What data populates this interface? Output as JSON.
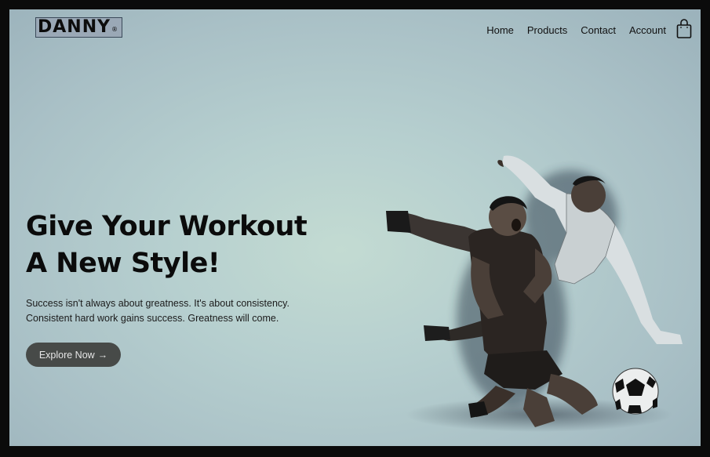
{
  "brand": {
    "name": "DANNY",
    "mark": "®"
  },
  "nav": {
    "items": [
      "Home",
      "Products",
      "Contact",
      "Account"
    ]
  },
  "icons": {
    "cart": "shopping-bag-icon",
    "arrow": "right-arrow-icon"
  },
  "hero": {
    "headline_lines": [
      "Give Your Workout",
      "A New Style!"
    ],
    "description_lines": [
      "Success isn't always about greatness. It's about consistency.",
      "Consistent hard work gains success. Greatness will come."
    ],
    "cta_label": "Explore Now",
    "cta_arrow": "→",
    "image_subject": "football-players-celebrating-image"
  },
  "colors": {
    "background": "#b6cfcf",
    "text": "#0b0b0b",
    "button": "#474a48",
    "button_text": "#e6e6e6"
  }
}
